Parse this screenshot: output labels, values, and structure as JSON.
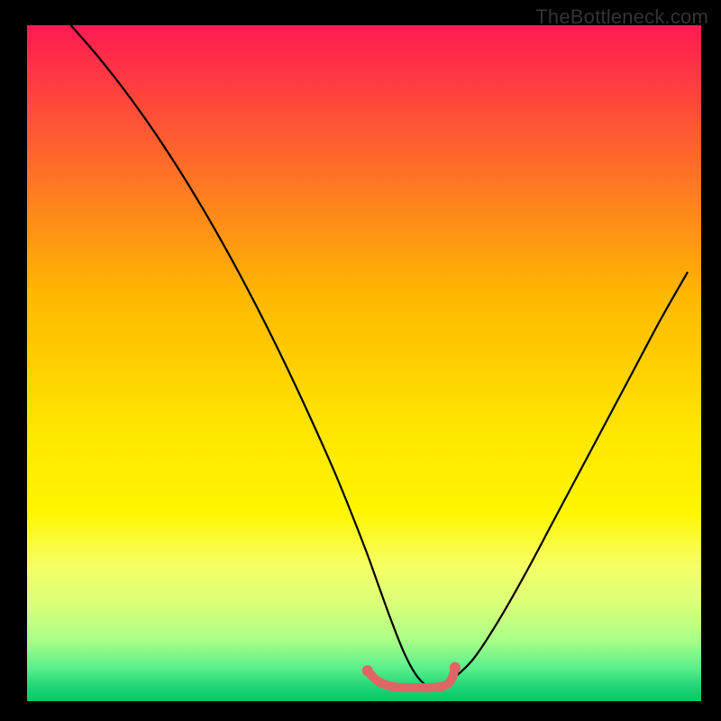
{
  "watermark": "TheBottleneck.com",
  "chart_data": {
    "type": "line",
    "title": "",
    "xlabel": "",
    "ylabel": "",
    "xlim": [
      0,
      100
    ],
    "ylim": [
      0,
      100
    ],
    "note": "Bottleneck curve over rainbow heat gradient. Black V-shaped curve with red highlighted segment near minimum. Values are normalized percentages read from the plot area.",
    "background_gradient_stops": [
      {
        "offset": 0.0,
        "color": "#ff1a52"
      },
      {
        "offset": 0.2,
        "color": "#ff6a2a"
      },
      {
        "offset": 0.4,
        "color": "#ffb800"
      },
      {
        "offset": 0.6,
        "color": "#ffe600"
      },
      {
        "offset": 0.72,
        "color": "#fff600"
      },
      {
        "offset": 0.8,
        "color": "#f6ff66"
      },
      {
        "offset": 0.86,
        "color": "#d8ff7a"
      },
      {
        "offset": 0.91,
        "color": "#a8ff88"
      },
      {
        "offset": 0.95,
        "color": "#5cf08c"
      },
      {
        "offset": 0.975,
        "color": "#26d878"
      },
      {
        "offset": 1.0,
        "color": "#00c864"
      }
    ],
    "series": [
      {
        "name": "bottleneck-curve",
        "color": "#000000",
        "x": [
          6.5,
          10,
          14,
          18,
          22,
          26,
          30,
          34,
          38,
          42,
          46,
          50,
          52,
          54,
          56,
          58,
          60,
          62,
          66,
          70,
          74,
          78,
          82,
          86,
          90,
          94,
          98
        ],
        "y": [
          100,
          96,
          91,
          85.5,
          79.5,
          73,
          66,
          58.5,
          50.5,
          42,
          33,
          23,
          17.5,
          12,
          7,
          3.5,
          2,
          2.5,
          6,
          12,
          19,
          26.5,
          34,
          41.5,
          49,
          56.5,
          63.5
        ]
      },
      {
        "name": "optimal-range-highlight",
        "color": "#e06666",
        "stroke_width": 10,
        "x": [
          50.5,
          52,
          54,
          56,
          58,
          60,
          62,
          63,
          63.5
        ],
        "y": [
          4.5,
          3.0,
          2.2,
          2.0,
          2.0,
          2.0,
          2.3,
          3.3,
          5.0
        ]
      }
    ],
    "highlight_endpoints": [
      {
        "x": 50.5,
        "y": 4.5
      },
      {
        "x": 63.5,
        "y": 5.0
      }
    ]
  }
}
